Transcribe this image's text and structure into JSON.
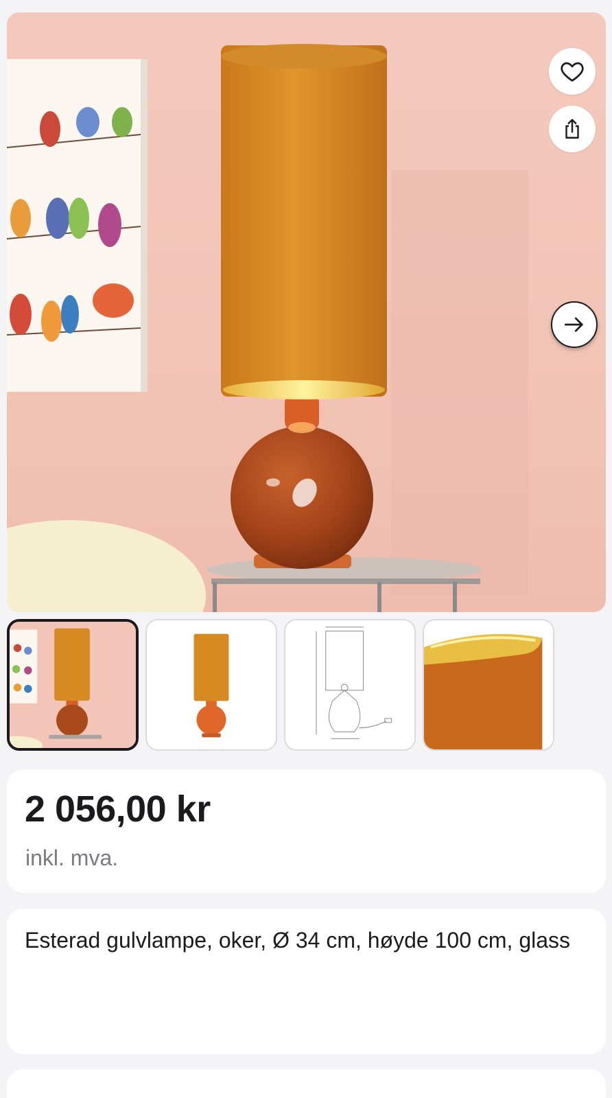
{
  "gallery": {
    "hero_alt": "Esterad gulvlampe, oker",
    "favorite_icon": "heart-icon",
    "share_icon": "share-icon",
    "next_icon": "arrow-right-icon",
    "selected_index": 0,
    "thumbnails": [
      {
        "kind": "room-photo"
      },
      {
        "kind": "product-photo"
      },
      {
        "kind": "dimension-drawing"
      },
      {
        "kind": "shade-detail"
      }
    ]
  },
  "price": {
    "amount": "2 056,00 kr",
    "vat_note": "inkl. mva."
  },
  "product": {
    "title": "Esterad gulvlampe, oker, Ø 34 cm, høyde 100 cm, glass"
  },
  "colors": {
    "wall": "#f4c9bd",
    "shade": "#d88a22",
    "base": "#a94a1c",
    "text": "#1b1b1f",
    "muted": "#7a7a82"
  }
}
